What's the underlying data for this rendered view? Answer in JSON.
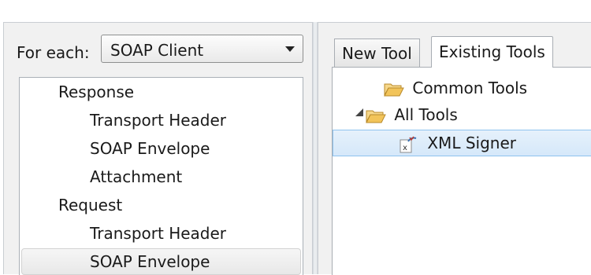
{
  "left": {
    "for_each_label": "For each:",
    "dropdown_value": "SOAP Client",
    "tree": [
      {
        "label": "Response",
        "level": 0
      },
      {
        "label": "Transport Header",
        "level": 1
      },
      {
        "label": "SOAP Envelope",
        "level": 1
      },
      {
        "label": "Attachment",
        "level": 1
      },
      {
        "label": "Request",
        "level": 0
      },
      {
        "label": "Transport Header",
        "level": 1
      },
      {
        "label": "SOAP Envelope",
        "level": 1,
        "selected": true
      }
    ]
  },
  "right": {
    "tabs": [
      {
        "label": "New Tool",
        "active": false
      },
      {
        "label": "Existing Tools",
        "active": true
      }
    ],
    "tree": [
      {
        "label": "Common Tools",
        "icon": "folder-icon"
      },
      {
        "label": "All Tools",
        "icon": "folder-icon",
        "expanded": true
      },
      {
        "label": "XML Signer",
        "icon": "xml-signer-icon",
        "selected": true
      }
    ]
  },
  "colors": {
    "selection_blue": "#d5e8fa",
    "selection_border": "#8ec3ef",
    "folder": "#f2c45a"
  }
}
